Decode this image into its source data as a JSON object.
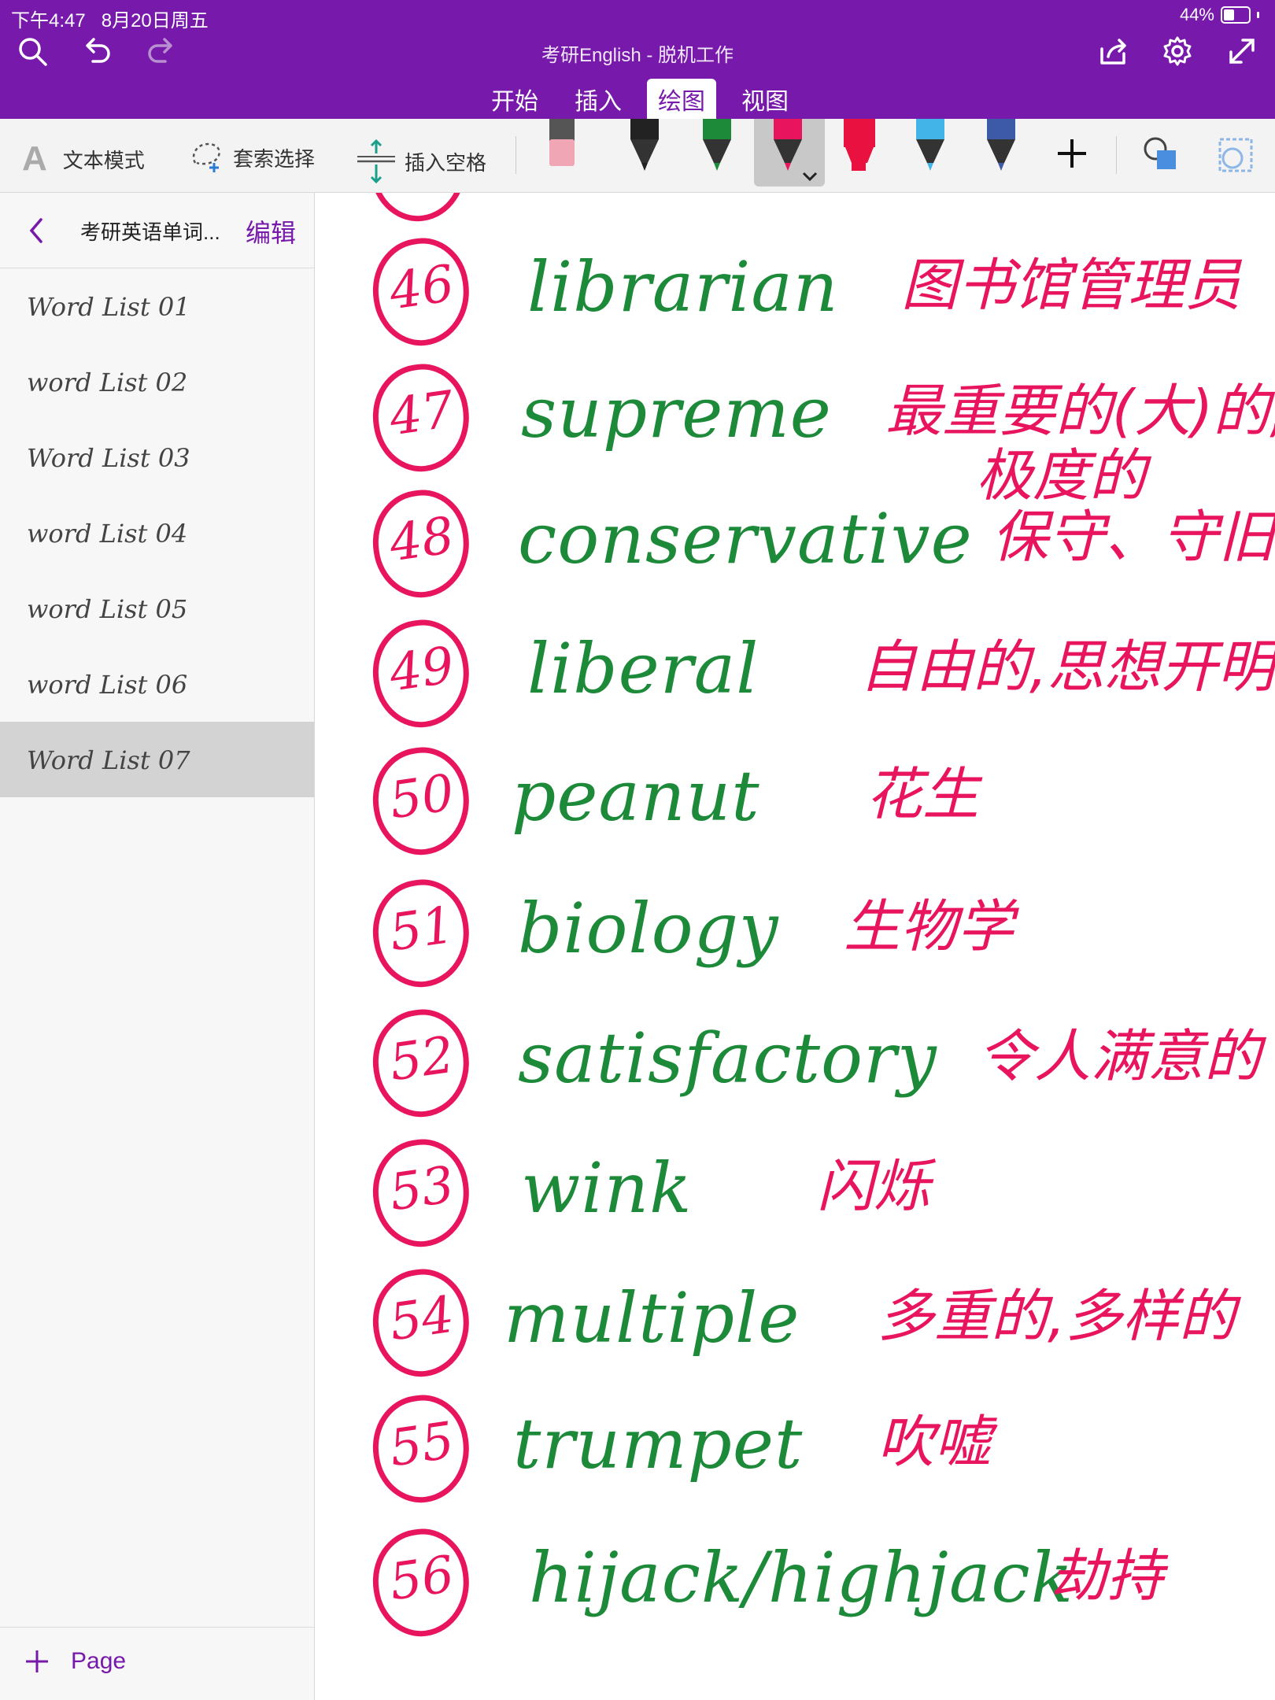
{
  "status": {
    "time": "下午4:47",
    "date": "8月20日周五",
    "battery": "44%",
    "battery_level": 0.44
  },
  "app": {
    "title": "考研English - 脱机工作"
  },
  "tabs": [
    "开始",
    "插入",
    "绘图",
    "视图"
  ],
  "active_tab": 2,
  "toolbar": {
    "text_mode": "文本模式",
    "lasso": "套索选择",
    "insert_space": "插入空格"
  },
  "pens": [
    {
      "name": "eraser",
      "color": "#f1a6b6"
    },
    {
      "name": "pen-black",
      "color": "#222222"
    },
    {
      "name": "pen-green",
      "color": "#1d8a3a"
    },
    {
      "name": "pen-pink",
      "color": "#e8145e",
      "selected": true
    },
    {
      "name": "highlighter-red",
      "color": "#e8113f"
    },
    {
      "name": "pen-blue",
      "color": "#42b4e8"
    },
    {
      "name": "pen-galaxy",
      "color": "#3d5aa8"
    }
  ],
  "sidebar": {
    "section_title": "考研英语单词...",
    "edit_label": "编辑",
    "pages": [
      "Word List 01",
      "word List 02",
      "Word List 03",
      "word List 04",
      "word List 05",
      "word List 06",
      "Word List 07"
    ],
    "selected_page": 6,
    "add_page_label": "Page"
  },
  "note_entries": [
    {
      "num": "46",
      "en": "librarian",
      "zh": "图书馆管理员"
    },
    {
      "num": "47",
      "en": "supreme",
      "zh": "最重要的(大)的,",
      "zh2": "极度的"
    },
    {
      "num": "48",
      "en": "conservative",
      "zh": "保守、守旧"
    },
    {
      "num": "49",
      "en": "liberal",
      "zh": "自由的,思想开明的"
    },
    {
      "num": "50",
      "en": "peanut",
      "zh": "花生"
    },
    {
      "num": "51",
      "en": "biology",
      "zh": "生物学"
    },
    {
      "num": "52",
      "en": "satisfactory",
      "zh": "令人满意的"
    },
    {
      "num": "53",
      "en": "wink",
      "zh": "闪烁"
    },
    {
      "num": "54",
      "en": "multiple",
      "zh": "多重的,多样的"
    },
    {
      "num": "55",
      "en": "trumpet",
      "zh": "吹嘘"
    },
    {
      "num": "56",
      "en": "hijack/highjack",
      "zh": "劫持"
    }
  ]
}
